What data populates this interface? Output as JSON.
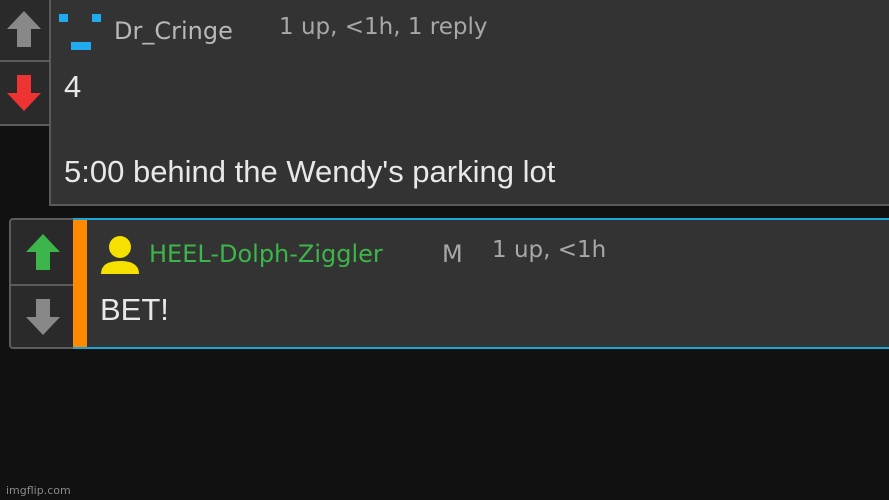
{
  "colors": {
    "background": "#111111",
    "card": "#333333",
    "reply_border": "#1aa6d6",
    "mod_accent": "#ff8a00",
    "upvote_active": "#3cb54a",
    "downvote_active": "#ee3333",
    "vote_inactive": "#888888",
    "username_green": "#3cb54a",
    "username_gray": "#b8b8b8",
    "avatar_blue": "#22aaee",
    "avatar_yellow": "#f5e000"
  },
  "comment": {
    "avatar_icon": "pixel-face-icon",
    "username": "Dr_Cringe",
    "meta": "1 up, <1h, 1 reply",
    "line1": "4",
    "line2": "5:00 behind the Wendy's parking lot",
    "upvote_state": "inactive",
    "downvote_state": "active"
  },
  "reply": {
    "avatar_icon": "user-silhouette-icon",
    "username": "HEEL-Dolph-Ziggler",
    "badge": "M",
    "meta": "1 up, <1h",
    "text": "BET!",
    "upvote_state": "active",
    "downvote_state": "inactive"
  },
  "watermark": "imgflip.com"
}
